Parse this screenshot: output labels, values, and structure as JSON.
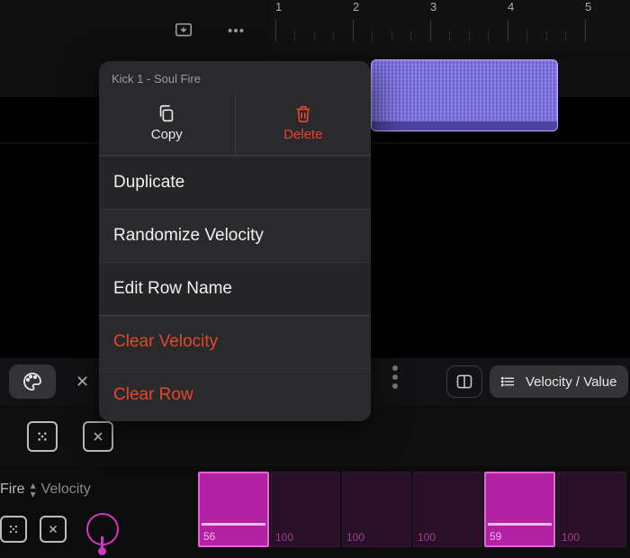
{
  "ruler": {
    "numbers": [
      "1",
      "2",
      "3",
      "4",
      "5"
    ]
  },
  "popover": {
    "title": "Kick 1 - Soul Fire",
    "copy_label": "Copy",
    "delete_label": "Delete",
    "items": [
      {
        "label": "Duplicate",
        "danger": false
      },
      {
        "label": "Randomize Velocity",
        "danger": false
      },
      {
        "label": "Edit Row Name",
        "danger": false
      },
      {
        "label": "Clear Velocity",
        "danger": true
      },
      {
        "label": "Clear Row",
        "danger": true
      }
    ]
  },
  "mid_bar": {
    "velocity_value_label": "Velocity / Value"
  },
  "bottom": {
    "row_label_left": "Fire",
    "row_label_right": "Velocity"
  },
  "steps": [
    {
      "value": "56",
      "active": true
    },
    {
      "value": "100",
      "active": false
    },
    {
      "value": "100",
      "active": false
    },
    {
      "value": "100",
      "active": false
    },
    {
      "value": "59",
      "active": true
    },
    {
      "value": "100",
      "active": false
    }
  ]
}
